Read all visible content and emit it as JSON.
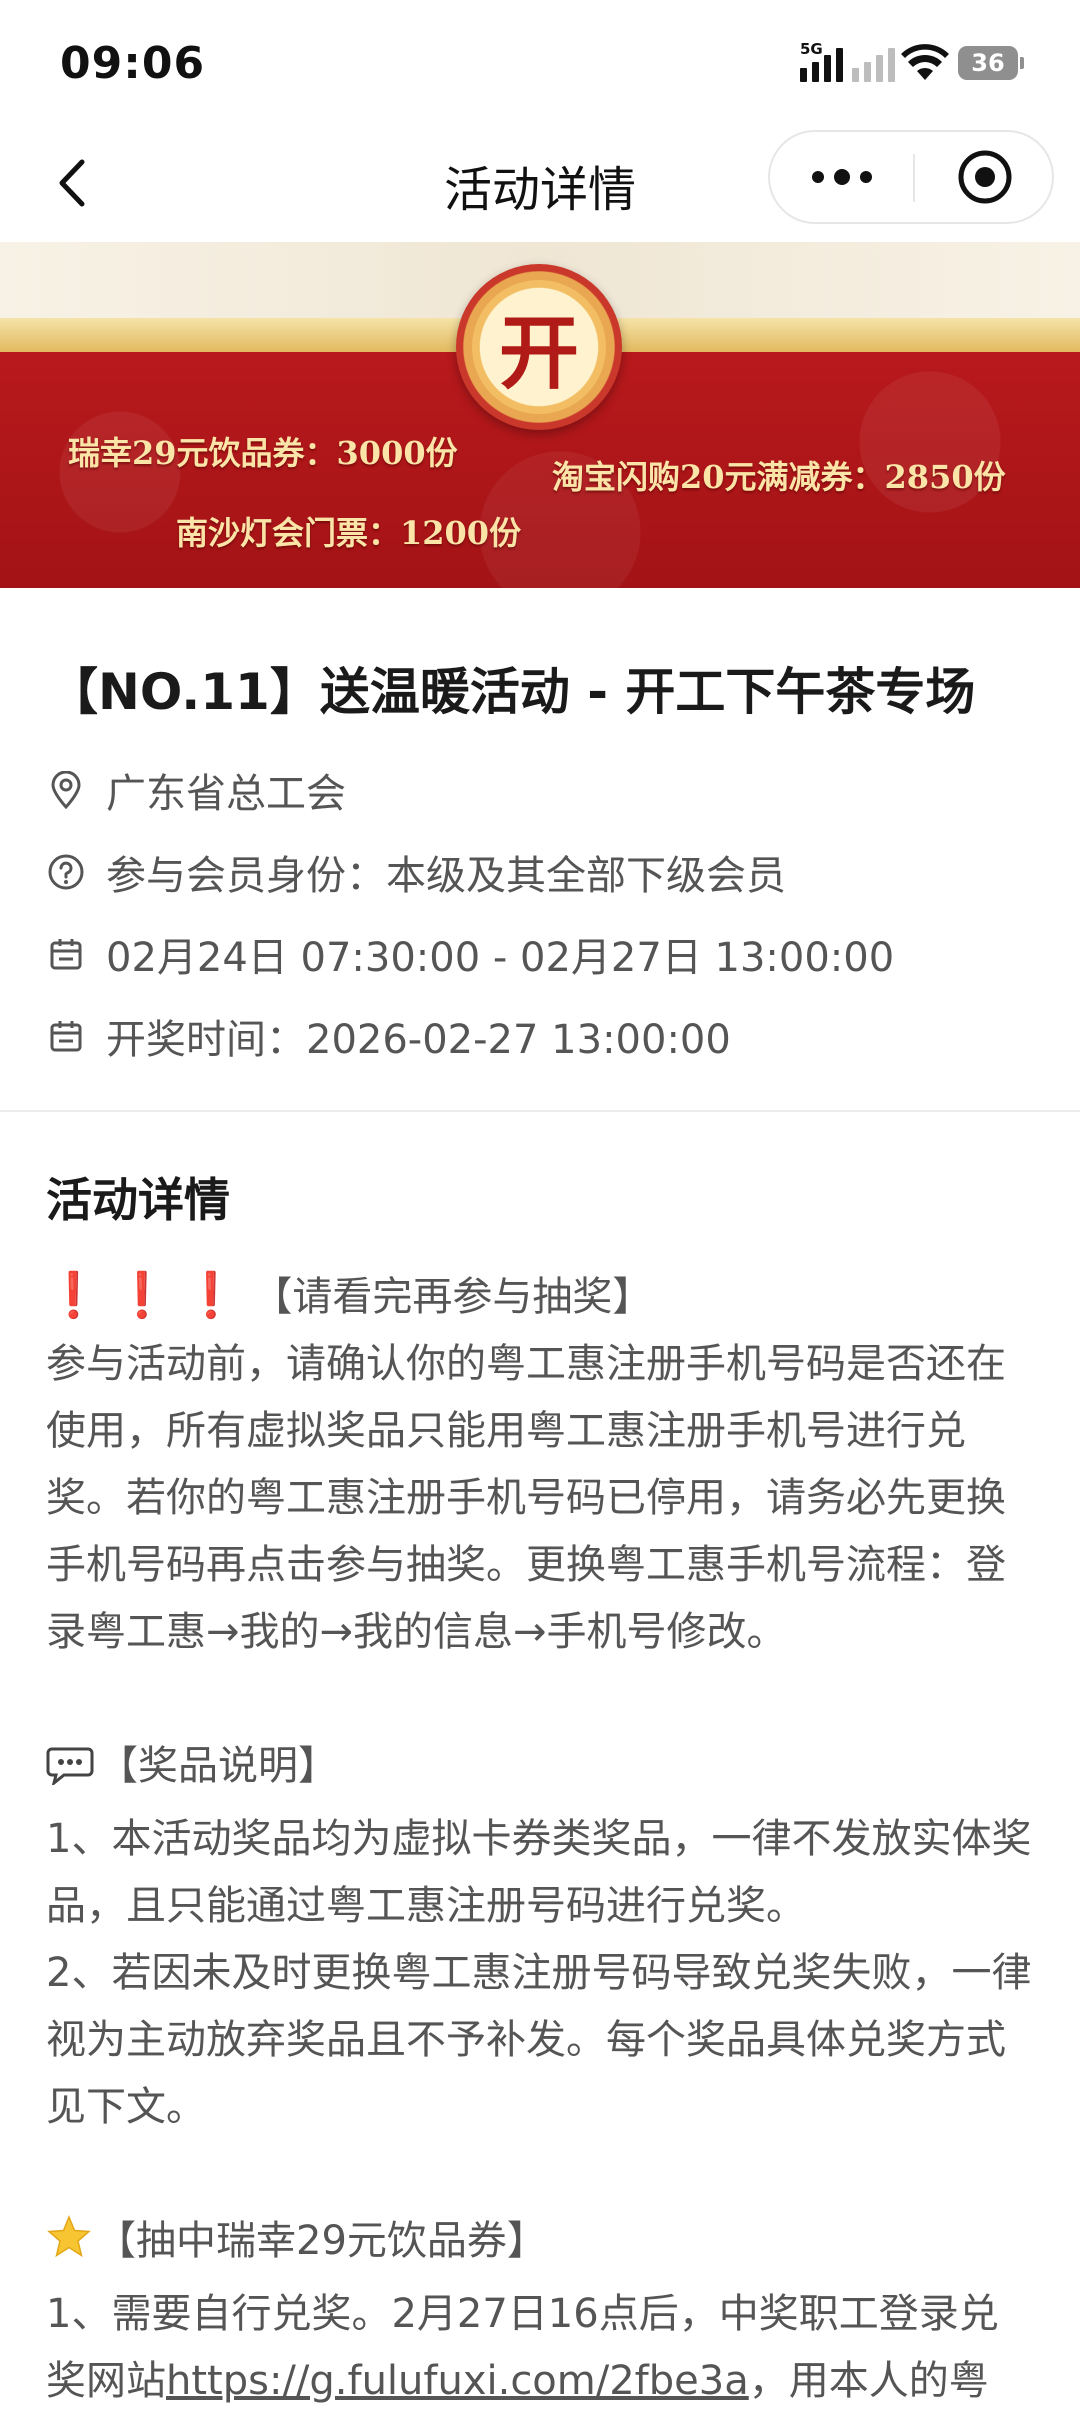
{
  "status_bar": {
    "time": "09:06",
    "network": "5G",
    "battery": "36"
  },
  "nav": {
    "title": "活动详情"
  },
  "banner": {
    "seal_text": "开",
    "prizes": [
      "瑞幸29元饮品券：3000份",
      "淘宝闪购20元满减券：2850份",
      "南沙灯会门票：1200份"
    ]
  },
  "activity": {
    "title": "【NO.11】送温暖活动 - 开工下午茶专场",
    "organizer": "广东省总工会",
    "member_scope": "参与会员身份：本级及其全部下级会员",
    "time_range": "02月24日 07:30:00 - 02月27日 13:00:00",
    "draw_time": "开奖时间：2026-02-27 13:00:00"
  },
  "details": {
    "heading": "活动详情",
    "notice_marks": "❗❗❗",
    "notice_title": "【请看完再参与抽奖】",
    "notice_body": "参与活动前，请确认你的粤工惠注册手机号码是否还在使用，所有虚拟奖品只能用粤工惠注册手机号进行兑奖。若你的粤工惠注册手机号码已停用，请务必先更换手机号码再点击参与抽奖。更换粤工惠手机号流程：登录粤工惠→我的→我的信息→手机号修改。",
    "prize_desc_title": "【奖品说明】",
    "prize_desc_1": "1、本活动奖品均为虚拟卡券类奖品，一律不发放实体奖品，且只能通过粤工惠注册号码进行兑奖。",
    "prize_desc_2": "2、若因未及时更换粤工惠注册号码导致兑奖失败，一律视为主动放弃奖品且不予补发。每个奖品具体兑奖方式见下文。",
    "luckin_title": "【抽中瑞幸29元饮品券】",
    "luckin_1_a": "1、需要自行兑奖。2月27日16点后，中奖职工登录兑奖网站",
    "luckin_1_link": "https://g.fulufuxi.com/2fbe3a",
    "luckin_1_b": "，用本人的粤"
  },
  "colors": {
    "banner_red": "#a71418",
    "gold": "#e2b95f",
    "alert_red": "#e0302b"
  }
}
